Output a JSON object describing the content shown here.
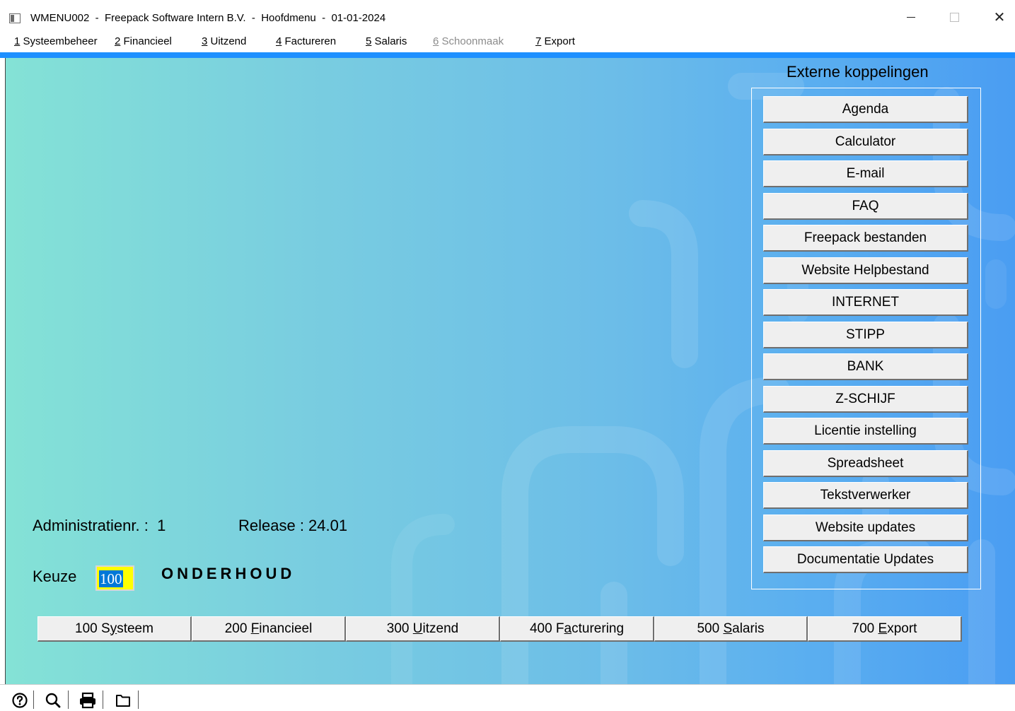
{
  "window": {
    "title": "WMENU002  -  Freepack Software Intern B.V.  -  Hoofdmenu  -  01-01-2024",
    "minimize_icon": "minimize-icon",
    "maximize_icon": "maximize-icon",
    "close_icon": "close-icon",
    "close_glyph": "✕"
  },
  "menubar": {
    "items": [
      {
        "acc": "1",
        "label": " Systeembeheer",
        "disabled": false
      },
      {
        "acc": "2",
        "label": " Financieel",
        "disabled": false
      },
      {
        "acc": "3",
        "label": " Uitzend",
        "disabled": false
      },
      {
        "acc": "4",
        "label": " Factureren",
        "disabled": false
      },
      {
        "acc": "5",
        "label": " Salaris",
        "disabled": false
      },
      {
        "acc": "6",
        "label": " Schoonmaak",
        "disabled": true
      },
      {
        "acc": "7",
        "label": " Export",
        "disabled": false
      }
    ]
  },
  "external": {
    "title": "Externe koppelingen",
    "buttons": [
      "Agenda",
      "Calculator",
      "E-mail",
      "FAQ",
      "Freepack bestanden",
      "Website Helpbestand",
      "INTERNET",
      "STIPP",
      "BANK",
      "Z-SCHIJF",
      "Licentie instelling",
      "Spreadsheet",
      "Tekstverwerker",
      "Website updates",
      "Documentatie Updates"
    ]
  },
  "info": {
    "admin_label": "Administratienr. :  1",
    "release_label": "Release : 24.01",
    "keuze_label": "Keuze",
    "keuze_value": "100",
    "keuze_description": "ONDERHOUD"
  },
  "bottom_buttons": [
    {
      "pre": "100 S",
      "acc": "y",
      "post": "steem"
    },
    {
      "pre": "200 ",
      "acc": "F",
      "post": "inancieel"
    },
    {
      "pre": "300 ",
      "acc": "U",
      "post": "itzend"
    },
    {
      "pre": "400 F",
      "acc": "a",
      "post": "cturering"
    },
    {
      "pre": "500 ",
      "acc": "S",
      "post": "alaris"
    },
    {
      "pre": "700 ",
      "acc": "E",
      "post": "xport"
    }
  ],
  "statusbar": {
    "icons": [
      "help-icon",
      "search-icon",
      "print-icon",
      "folder-icon"
    ]
  },
  "colors": {
    "accent_bar": "#1e90ff",
    "input_bg": "#ffff00",
    "selection": "#0078d7"
  }
}
